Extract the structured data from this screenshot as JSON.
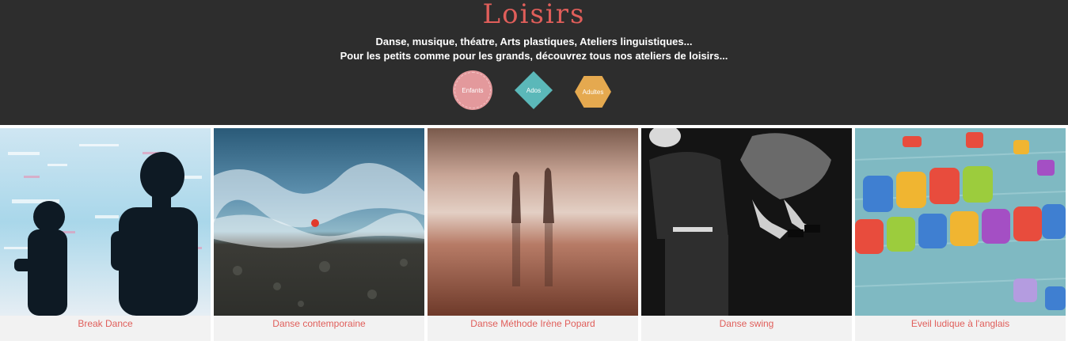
{
  "header": {
    "title": "Loisirs",
    "subtitle_line1": "Danse, musique, théatre, Arts plastiques, Ateliers linguistiques...",
    "subtitle_line2": "Pour les petits comme pour les grands, découvrez tous nos ateliers de loisirs..."
  },
  "badges": {
    "enfants": "Enfants",
    "ados": "Ados",
    "adultes": "Adultes"
  },
  "cards": [
    {
      "label": "Break Dance"
    },
    {
      "label": "Danse contemporaine"
    },
    {
      "label": "Danse Méthode Irène Popard"
    },
    {
      "label": "Danse swing"
    },
    {
      "label": "Eveil ludique à l'anglais"
    }
  ],
  "colors": {
    "accent": "#e05e5a",
    "enfants": "#e3999c",
    "ados": "#5bb8b9",
    "adultes": "#e5a94f",
    "header_bg": "#2d2d2d"
  }
}
